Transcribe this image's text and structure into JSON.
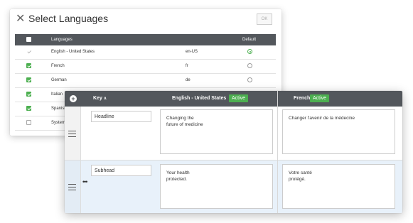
{
  "dialog": {
    "title": "Select Languages",
    "close_icon": "✕",
    "ok_label": "OK",
    "columns": {
      "languages": "Languages",
      "default": "Default"
    },
    "rows": [
      {
        "name": "English - United States",
        "code": "en-US",
        "checkbox": "disabled-checked",
        "default": true
      },
      {
        "name": "French",
        "code": "fr",
        "checkbox": "checked",
        "default": false
      },
      {
        "name": "German",
        "code": "de",
        "checkbox": "checked",
        "default": false
      },
      {
        "name": "Italian",
        "code": "",
        "checkbox": "checked",
        "default": false
      },
      {
        "name": "Spanish",
        "code": "",
        "checkbox": "checked",
        "default": false
      },
      {
        "name": "System",
        "code": "",
        "checkbox": "unchecked",
        "default": false
      }
    ]
  },
  "panel": {
    "add_icon": "+",
    "header": {
      "key_label": "Key",
      "sort_icon": "∧",
      "en_label": "English - United States",
      "en_status": "Active",
      "fr_label": "French",
      "fr_status": "Active"
    },
    "rows": [
      {
        "key": "Headline",
        "english": "Changing the\nfuture of medicine",
        "french": "Changer l'avenir de la médecine",
        "selected": false
      },
      {
        "key": "Subhead",
        "english": "Your health\nprotected.",
        "french": "Votre santé\nprotégé.",
        "selected": true
      }
    ],
    "row_menu_icon": "•••"
  },
  "colors": {
    "header_bg": "#53575c",
    "accent_green": "#4caf50",
    "selected_row": "#e8f1fa"
  }
}
